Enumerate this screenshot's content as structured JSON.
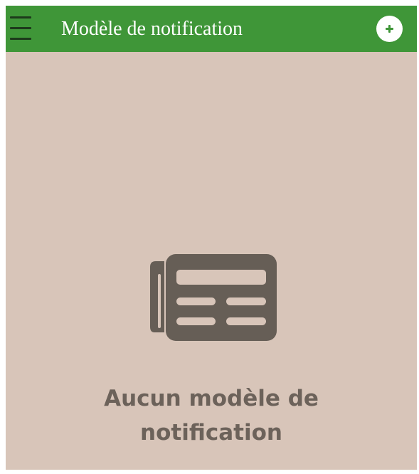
{
  "app_bar": {
    "title": "Modèle de notification",
    "background_color": "#3f9638",
    "menu_icon": "hamburger-menu-icon",
    "add_icon": "plus-icon"
  },
  "main": {
    "background_color": "#d8c5b9",
    "empty_state": {
      "icon": "newspaper-icon",
      "message_line_1": "Aucun modèle de",
      "message_line_2": "notification",
      "text_color": "#6c625a"
    }
  }
}
